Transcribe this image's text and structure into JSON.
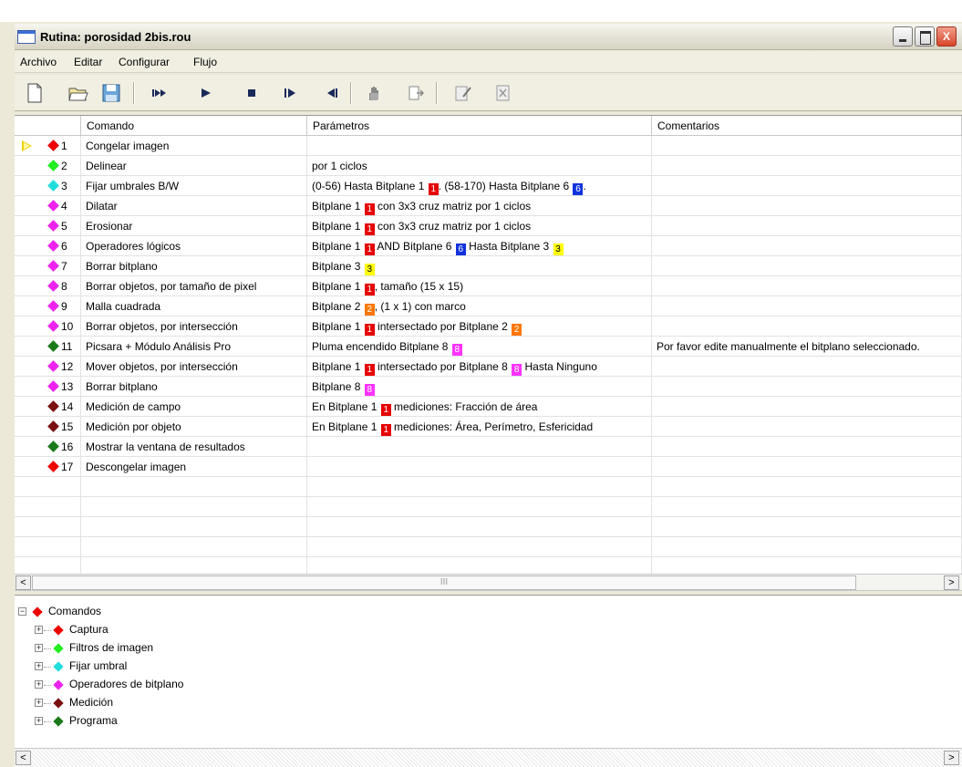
{
  "window": {
    "title": "Rutina: porosidad 2bis.rou",
    "min_label": "",
    "max_label": "",
    "close_label": "X"
  },
  "menu": [
    "Archivo",
    "Editar",
    "Configurar",
    "Flujo"
  ],
  "toolbar": [
    {
      "name": "new-file-icon"
    },
    {
      "name": "open-folder-icon"
    },
    {
      "name": "save-icon"
    },
    {
      "name": "run-all-icon"
    },
    {
      "name": "play-icon"
    },
    {
      "name": "stop-icon"
    },
    {
      "name": "step-forward-icon"
    },
    {
      "name": "step-back-icon"
    },
    {
      "name": "hand-icon"
    },
    {
      "name": "export-icon"
    },
    {
      "name": "edit-icon"
    },
    {
      "name": "delete-icon"
    }
  ],
  "columns": [
    "Comando",
    "Parámetros",
    "Comentarios"
  ],
  "colors": {
    "red": "#ff0000",
    "green": "#00dd00",
    "cyan": "#00ddee",
    "magenta": "#ff00ff",
    "dark_red": "#800000",
    "dark_green": "#008000",
    "yellow": "#ffff00",
    "blue": "#0033cc",
    "orange": "#ff6600",
    "pink": "#ff40ff"
  },
  "rows": [
    {
      "n": "1",
      "icon": "#ee0000",
      "cmd": "Congelar imagen",
      "params": "",
      "comment": "",
      "current": true
    },
    {
      "n": "2",
      "icon": "#22ee22",
      "cmd": "Delinear",
      "params": "por 1 ciclos",
      "comment": ""
    },
    {
      "n": "3",
      "icon": "#22dddd",
      "cmd": "Fijar umbrales B/W",
      "params": "(0-56) Hasta Bitplane 1 [1]. (58-170) Hasta Bitplane 6 [6].",
      "comment": ""
    },
    {
      "n": "4",
      "icon": "#ee22ee",
      "cmd": "Dilatar",
      "params": "Bitplane 1 [1] con 3x3 cruz matriz por 1 ciclos",
      "comment": ""
    },
    {
      "n": "5",
      "icon": "#ee22ee",
      "cmd": "Erosionar",
      "params": "Bitplane 1 [1] con 3x3 cruz matriz por 1 ciclos",
      "comment": ""
    },
    {
      "n": "6",
      "icon": "#ee22ee",
      "cmd": "Operadores lógicos",
      "params": "Bitplane 1 [1] AND Bitplane 6 [6] Hasta Bitplane 3 [3]",
      "comment": ""
    },
    {
      "n": "7",
      "icon": "#ee22ee",
      "cmd": "Borrar bitplano",
      "params": "Bitplane 3 [3]",
      "comment": ""
    },
    {
      "n": "8",
      "icon": "#ee22ee",
      "cmd": "Borrar objetos, por tamaño de pixel",
      "params": "Bitplane 1 [1], tamaño (15 x 15)",
      "comment": ""
    },
    {
      "n": "9",
      "icon": "#ee22ee",
      "cmd": "Malla cuadrada",
      "params": "Bitplane 2 [2], (1 x 1) con marco",
      "comment": ""
    },
    {
      "n": "10",
      "icon": "#ee22ee",
      "cmd": "Borrar objetos, por intersección",
      "params": "Bitplane 1 [1] intersectado por Bitplane 2 [2]",
      "comment": ""
    },
    {
      "n": "11",
      "icon": "#1a7a1a",
      "cmd": "Picsara + Módulo Análisis Pro",
      "params": "Pluma encendido Bitplane 8 [8]",
      "comment": "Por favor edite manualmente el bitplano seleccionado."
    },
    {
      "n": "12",
      "icon": "#ee22ee",
      "cmd": "Mover objetos, por intersección",
      "params": "Bitplane 1 [1] intersectado por Bitplane 8 [8] Hasta Ninguno",
      "comment": ""
    },
    {
      "n": "13",
      "icon": "#ee22ee",
      "cmd": "Borrar bitplano",
      "params": "Bitplane 8 [8]",
      "comment": ""
    },
    {
      "n": "14",
      "icon": "#7a1010",
      "cmd": "Medición de campo",
      "params": "En Bitplane 1 [1] mediciones: Fracción de área",
      "comment": ""
    },
    {
      "n": "15",
      "icon": "#7a1010",
      "cmd": "Medición por objeto",
      "params": "En Bitplane 1 [1] mediciones: Área, Perímetro, Esfericidad",
      "comment": ""
    },
    {
      "n": "16",
      "icon": "#1a7a1a",
      "cmd": "Mostrar la ventana de resultados",
      "params": "",
      "comment": ""
    },
    {
      "n": "17",
      "icon": "#ee0000",
      "cmd": "Descongelar imagen",
      "params": "",
      "comment": ""
    }
  ],
  "badge_colors": {
    "1": "#e60000",
    "2": "#ff7700",
    "3": "#ffff00",
    "6": "#1133dd",
    "8": "#ff33ff"
  },
  "badge_text_colors": {
    "1": "#ffffff",
    "2": "#ffffff",
    "3": "#000000",
    "6": "#ffffff",
    "8": "#ffffff"
  },
  "scroll": {
    "thumb_grip": "III",
    "left": "<",
    "right": ">"
  },
  "tree": {
    "root": {
      "label": "Comandos",
      "color": "#ee0000",
      "toggle": "−"
    },
    "children": [
      {
        "label": "Captura",
        "color": "#ee0000",
        "toggle": "+"
      },
      {
        "label": "Filtros de imagen",
        "color": "#22ee22",
        "toggle": "+"
      },
      {
        "label": "Fijar umbral",
        "color": "#22dddd",
        "toggle": "+"
      },
      {
        "label": "Operadores de bitplano",
        "color": "#ee22ee",
        "toggle": "+"
      },
      {
        "label": "Medición",
        "color": "#7a1010",
        "toggle": "+"
      },
      {
        "label": "Programa",
        "color": "#1a7a1a",
        "toggle": "+"
      }
    ]
  }
}
